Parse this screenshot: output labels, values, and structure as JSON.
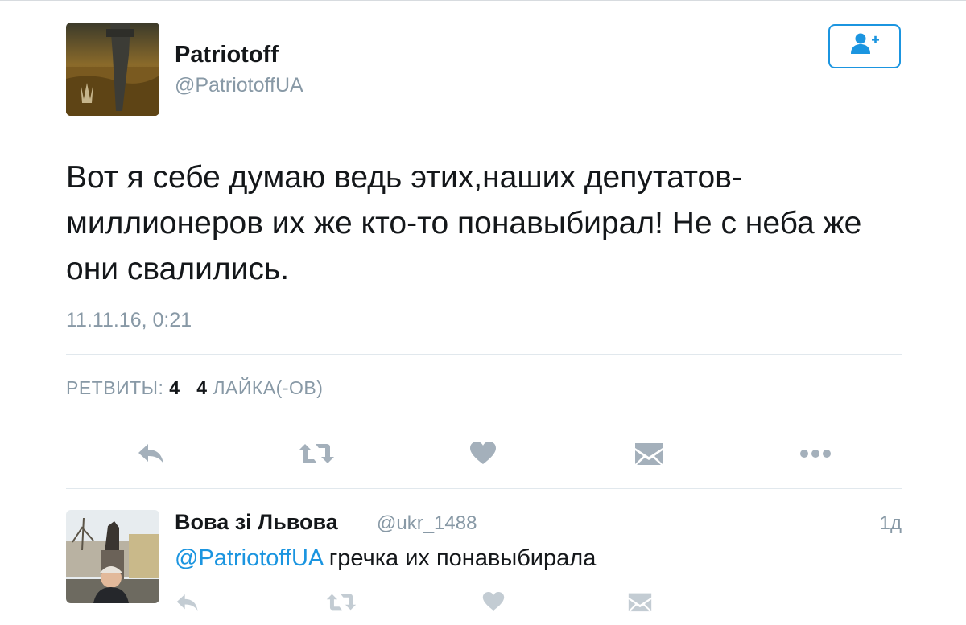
{
  "tweet": {
    "author_name": "Patriotoff",
    "author_handle": "@PatriotoffUA",
    "text": "Вот я себе думаю ведь этих,наших депутатов-миллионеров их же кто-то понавыбирал! Не с неба же они свалились.",
    "timestamp": "11.11.16, 0:21",
    "retweets_label": "РЕТВИТЫ:",
    "retweets_count": "4",
    "likes_count": "4",
    "likes_label": "ЛАЙКА(-ОВ)"
  },
  "actions": {
    "icons": [
      "reply-icon",
      "retweet-icon",
      "heart-icon",
      "message-icon",
      "more-icon"
    ]
  },
  "reply": {
    "author_name": "Вова зі Львова",
    "author_handle": "@ukr_1488",
    "time": "1д",
    "mention": "@PatriotoffUA",
    "text": " гречка их понавыбирала"
  },
  "colors": {
    "accent": "#1b95e0",
    "muted": "#8899a6",
    "icon": "#a4b0bb",
    "text": "#14171a"
  }
}
